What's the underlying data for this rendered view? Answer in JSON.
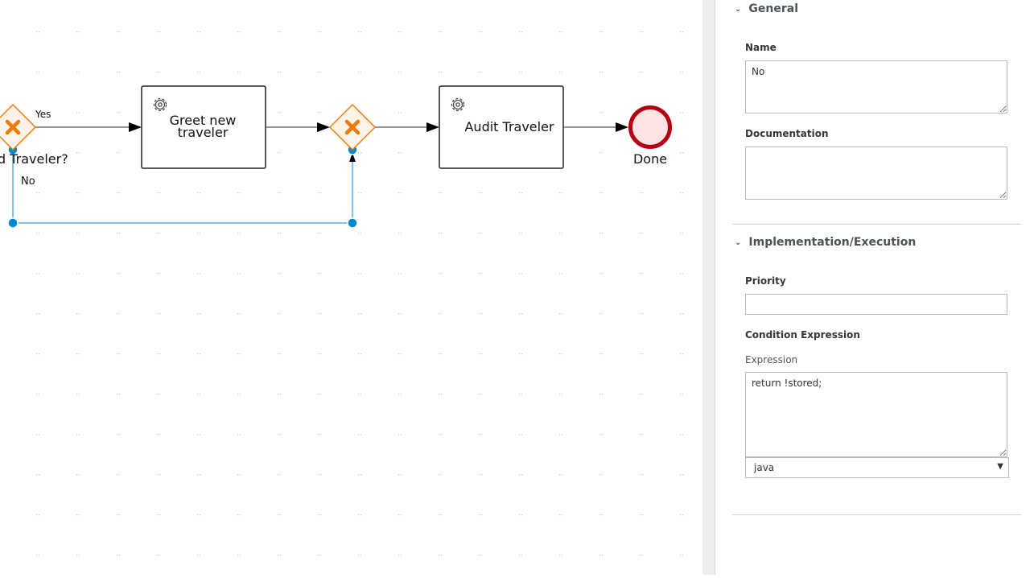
{
  "diagram": {
    "gateway1_label": "d Traveler?",
    "flow_yes_label": "Yes",
    "flow_no_label": "No",
    "task1_label_line1": "Greet new",
    "task1_label_line2": "traveler",
    "task2_label": "Audit Traveler",
    "end_event_label": "Done",
    "colors": {
      "gateway": "#ec7a08",
      "gateway_fill": "#fdf3e8",
      "end_event": "#b5000f",
      "end_fill": "#fde3e4",
      "selection": "#0088ce"
    }
  },
  "panel": {
    "general": {
      "title": "General",
      "name_label": "Name",
      "name_value": "No",
      "documentation_label": "Documentation",
      "documentation_value": ""
    },
    "implementation": {
      "title": "Implementation/Execution",
      "priority_label": "Priority",
      "priority_value": "",
      "condition_label": "Condition Expression",
      "expression_label": "Expression",
      "expression_value": "return !stored;",
      "language_value": "java"
    }
  }
}
